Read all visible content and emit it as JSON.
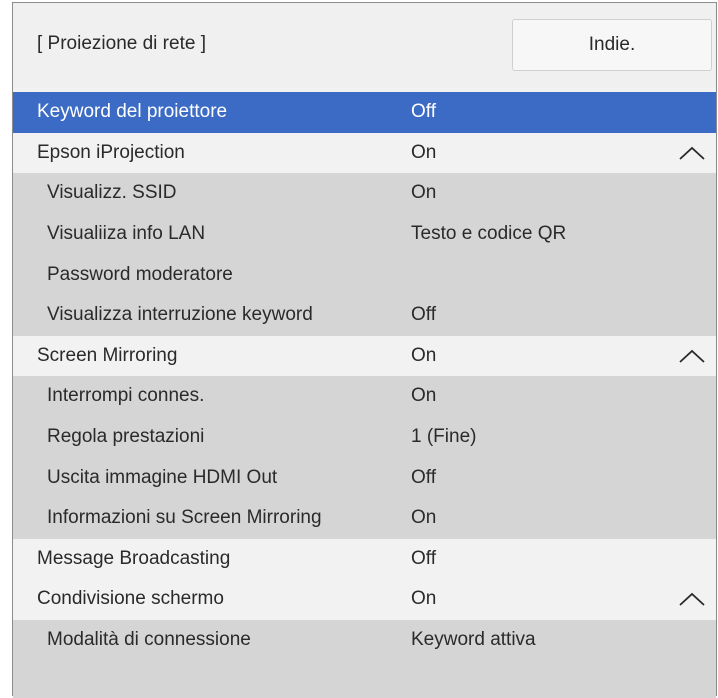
{
  "header": {
    "title": "[ Proiezione di rete ]",
    "back_label": "Indie."
  },
  "rows": [
    {
      "label": "Keyword del proiettore",
      "value": "Off"
    },
    {
      "label": "Epson iProjection",
      "value": "On"
    },
    {
      "label": "Visualizz. SSID",
      "value": "On"
    },
    {
      "label": "Visualiiza info LAN",
      "value": "Testo e codice QR"
    },
    {
      "label": "Password moderatore",
      "value": ""
    },
    {
      "label": "Visualizza interruzione keyword",
      "value": "Off"
    },
    {
      "label": "Screen Mirroring",
      "value": "On"
    },
    {
      "label": "Interrompi connes.",
      "value": "On"
    },
    {
      "label": "Regola prestazioni",
      "value": "1 (Fine)"
    },
    {
      "label": "Uscita immagine HDMI Out",
      "value": "Off"
    },
    {
      "label": "Informazioni su Screen Mirroring",
      "value": "On"
    },
    {
      "label": "Message Broadcasting",
      "value": "Off"
    },
    {
      "label": "Condivisione schermo",
      "value": "On"
    },
    {
      "label": "Modalità di connessione",
      "value": "Keyword attiva"
    }
  ],
  "colors": {
    "selected": "#3b6bc4",
    "submenu_bg": "#d5d5d5",
    "menu_bg": "#f2f2f2"
  }
}
